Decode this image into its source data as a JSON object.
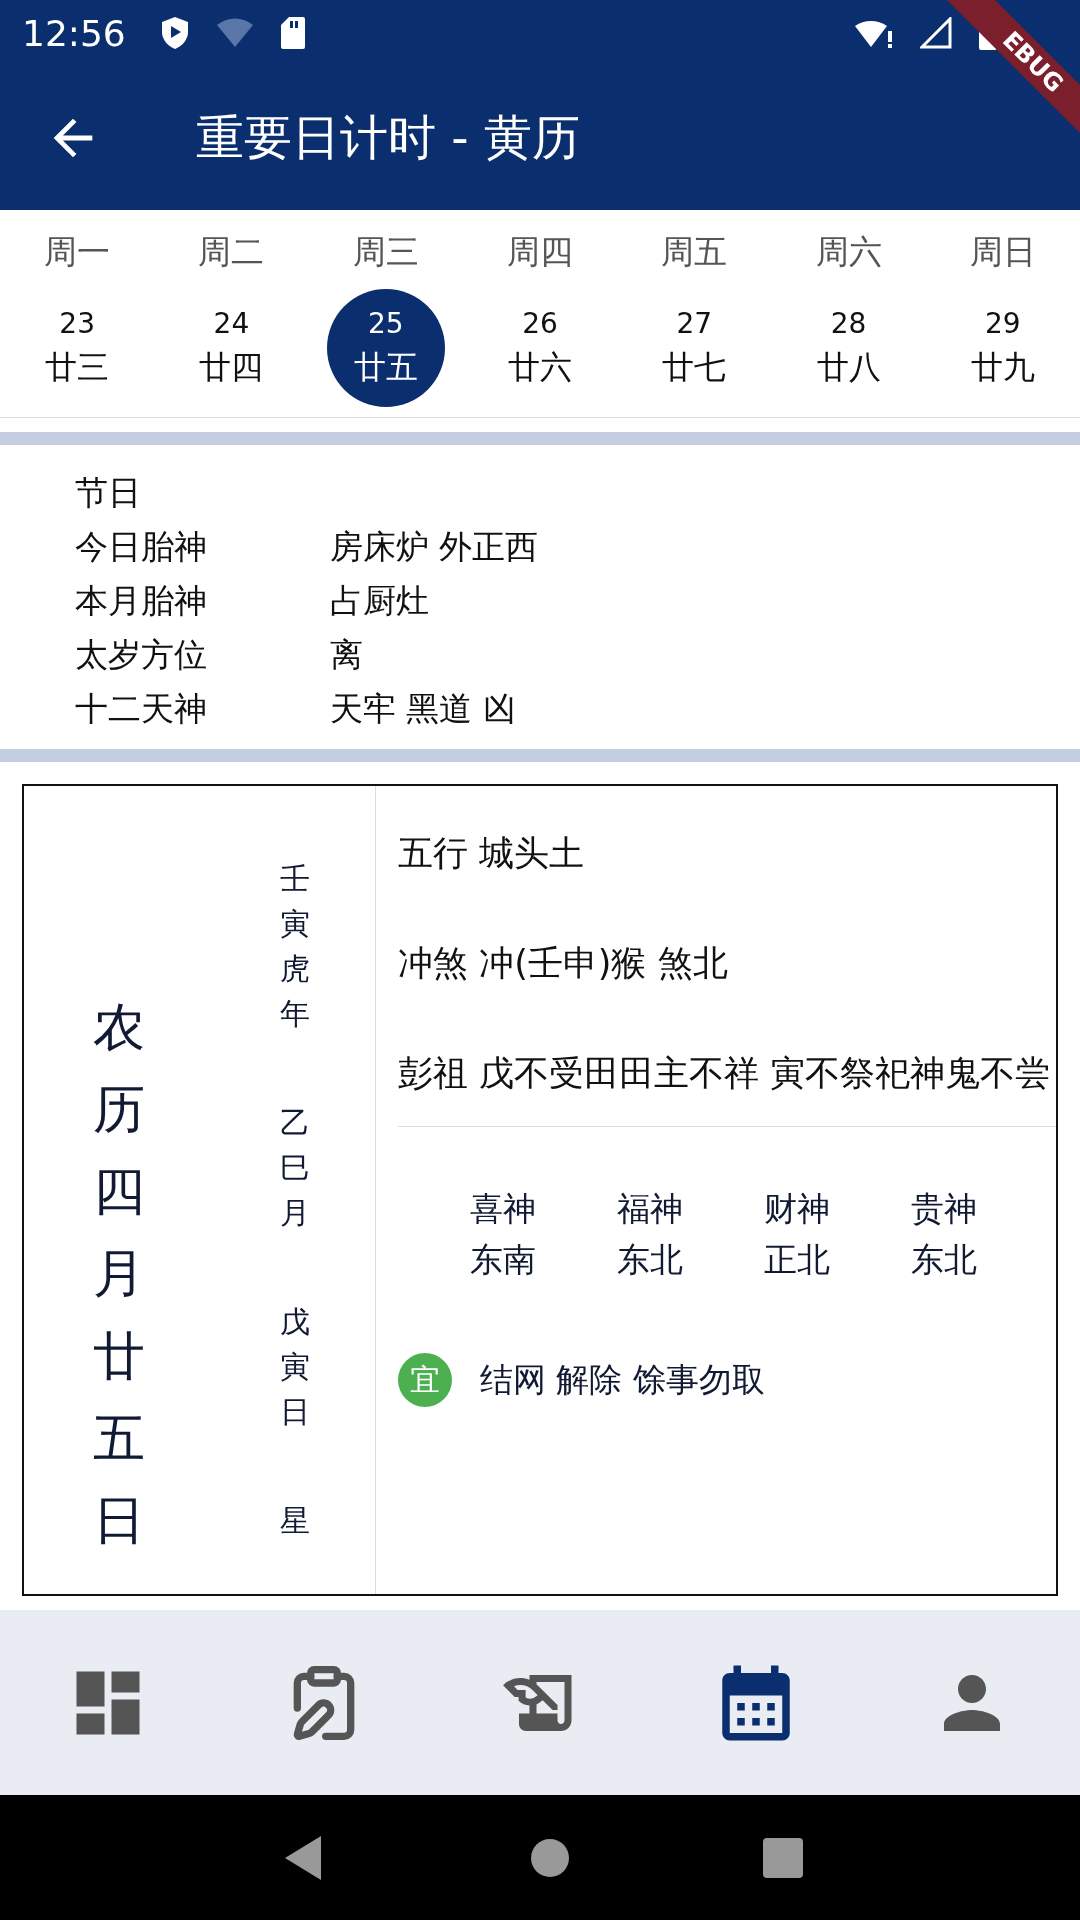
{
  "status_bar": {
    "time": "12:56"
  },
  "debug_banner": "EBUG",
  "app_bar": {
    "title": "重要日计时 - 黄历"
  },
  "week": [
    {
      "weekday": "周一",
      "day": "23",
      "lunar": "廿三",
      "selected": false
    },
    {
      "weekday": "周二",
      "day": "24",
      "lunar": "廿四",
      "selected": false
    },
    {
      "weekday": "周三",
      "day": "25",
      "lunar": "廿五",
      "selected": true
    },
    {
      "weekday": "周四",
      "day": "26",
      "lunar": "廿六",
      "selected": false
    },
    {
      "weekday": "周五",
      "day": "27",
      "lunar": "廿七",
      "selected": false
    },
    {
      "weekday": "周六",
      "day": "28",
      "lunar": "廿八",
      "selected": false
    },
    {
      "weekday": "周日",
      "day": "29",
      "lunar": "廿九",
      "selected": false
    }
  ],
  "info": [
    {
      "label": "节日"
    },
    {
      "label": "今日胎神",
      "value": "房床炉 外正西"
    },
    {
      "label": "本月胎神",
      "value": "占厨灶"
    },
    {
      "label": "太岁方位",
      "value": "离"
    },
    {
      "label": "十二天神",
      "value": "天牢 黑道 凶"
    }
  ],
  "almanac": {
    "lunar_date": "农历四月廿五日",
    "ganzhi": [
      "壬寅虎年",
      "乙巳月",
      "戊寅日",
      "星"
    ],
    "details": [
      "五行 城头土",
      "冲煞 冲(壬申)猴 煞北",
      "彭祖 戊不受田田主不祥 寅不祭祀神鬼不尝"
    ],
    "gods": [
      {
        "name": "喜神",
        "direction": "东南"
      },
      {
        "name": "福神",
        "direction": "东北"
      },
      {
        "name": "财神",
        "direction": "正北"
      },
      {
        "name": "贵神",
        "direction": "东北"
      }
    ],
    "activities": [
      {
        "kind": "yi",
        "badge": "宜",
        "text": "结网 解除 馀事勿取"
      }
    ]
  },
  "bottom_nav": [
    {
      "kind": "dashboard",
      "selected": false
    },
    {
      "kind": "clipboard",
      "selected": false
    },
    {
      "kind": "quill",
      "selected": false
    },
    {
      "kind": "calendar",
      "selected": true
    },
    {
      "kind": "person",
      "selected": false
    }
  ]
}
